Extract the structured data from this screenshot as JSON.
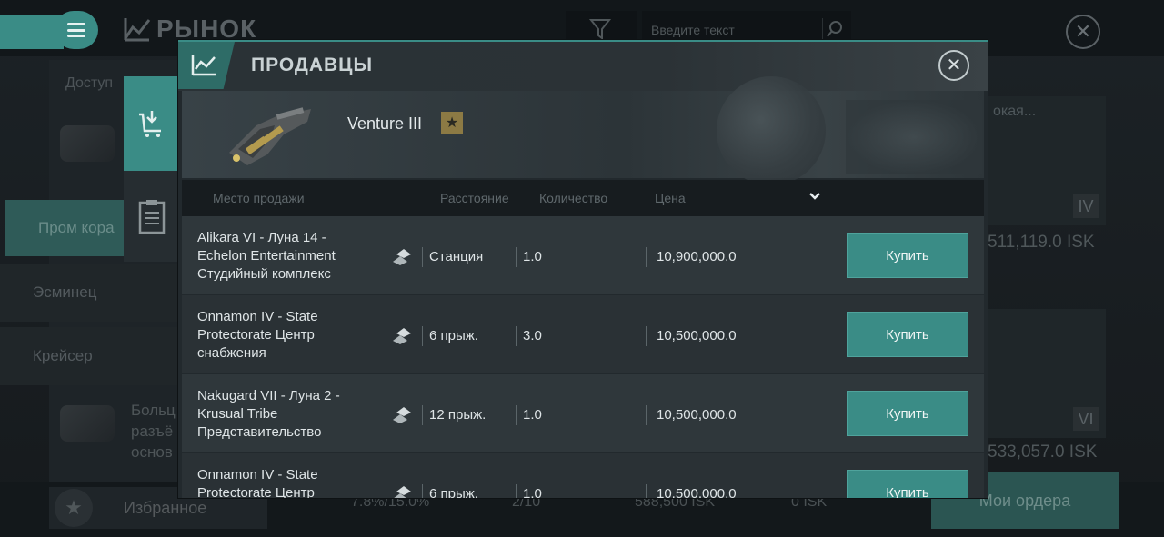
{
  "background": {
    "title": "РЫНОК",
    "search_placeholder": "Введите текст",
    "side_top": "Доступ",
    "side_items": [
      "Пром кора",
      "Эсминец",
      "Крейсер"
    ],
    "side_desc": [
      "Больц",
      "разъё",
      "основ"
    ],
    "favorites": "Избранное",
    "my_orders": "Мои ордера",
    "right_cards": [
      {
        "caption": "окая...",
        "tier": "IV",
        "price": "511,119.0 ISK"
      },
      {
        "caption": "",
        "tier": "VI",
        "price": "533,057.0 ISK"
      }
    ],
    "bottom_stats": [
      "7.8%/15.0%",
      "2/10",
      "588,500 ISK",
      "0 ISK"
    ]
  },
  "modal": {
    "title": "ПРОДАВЦЫ",
    "item_name": "Venture III",
    "columns": {
      "location": "Место продажи",
      "distance": "Расстояние",
      "quantity": "Количество",
      "price": "Цена"
    },
    "rows": [
      {
        "location": "Alikara VI - Луна 14 - Echelon Entertainment Студийный комплекс",
        "distance": "Станция",
        "quantity": "1.0",
        "price": "10,900,000.0",
        "action": "Купить"
      },
      {
        "location": "Onnamon IV - State Protectorate Центр снабжения",
        "distance": "6 прыж.",
        "quantity": "3.0",
        "price": "10,500,000.0",
        "action": "Купить"
      },
      {
        "location": "Nakugard VII - Луна 2 - Krusual Tribe Представительство",
        "distance": "12 прыж.",
        "quantity": "1.0",
        "price": "10,500,000.0",
        "action": "Купить"
      },
      {
        "location": "Onnamon IV - State Protectorate Центр",
        "distance": "6 прыж.",
        "quantity": "1.0",
        "price": "10,500,000.0",
        "action": "Купить"
      }
    ]
  },
  "colors": {
    "accent": "#3a8c86",
    "panel": "#2a3135",
    "text": "#dfe5e7"
  }
}
